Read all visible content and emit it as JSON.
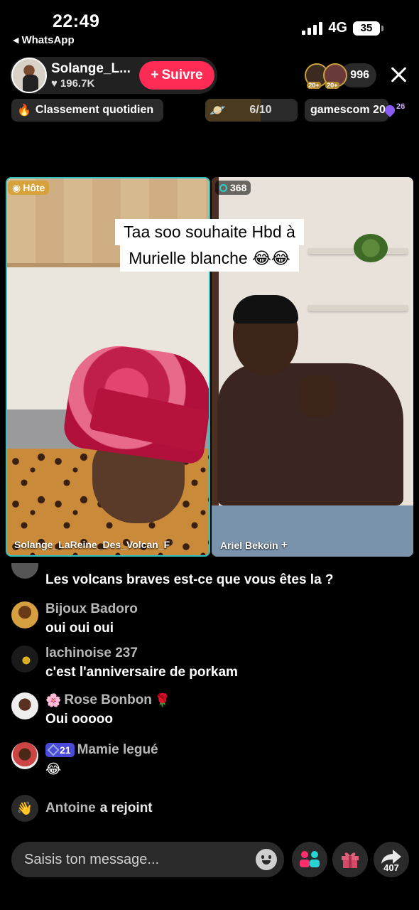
{
  "status_bar": {
    "time": "22:49",
    "back_app": "WhatsApp",
    "network": "4G",
    "battery": "35"
  },
  "host": {
    "name": "Solange_L...",
    "likes": "196.7K",
    "follow_label": "Suivre"
  },
  "viewers": {
    "count": "996",
    "badges": [
      "20+",
      "20+"
    ]
  },
  "topbar": {
    "ranking_label": "Classement quotidien",
    "goal_value": "6/10",
    "goal_progress": 0.6,
    "event_label": "gamescom 20",
    "event_badge": "26"
  },
  "video": {
    "host_tag": "Hôte",
    "guest_count": "368",
    "caption_line1": "Taa soo souhaite Hbd à",
    "caption_line2": "Murielle blanche 😂😂",
    "left_name": "Solange_LaReine_Des_Volcan_F",
    "right_name": "Ariel Bekoin"
  },
  "chat": [
    {
      "user": "",
      "message": "Les volcans braves est-ce que vous êtes la ?"
    },
    {
      "user": "Bijoux Badoro",
      "message": "oui oui oui"
    },
    {
      "user": "lachinoise 237",
      "message": "c'est l'anniversaire de porkam"
    },
    {
      "user": "Rose Bonbon",
      "message": "Oui ooooo"
    },
    {
      "user": "Mamie legué",
      "level": "21",
      "message": "😂"
    }
  ],
  "join_notice": {
    "user": "Antoine",
    "action": "a rejoint"
  },
  "bottom": {
    "input_placeholder": "Saisis ton message...",
    "share_count": "407"
  },
  "colors": {
    "accent": "#fe2c55",
    "host_border": "#2dc2c2",
    "host_tag": "#d8a23a"
  }
}
